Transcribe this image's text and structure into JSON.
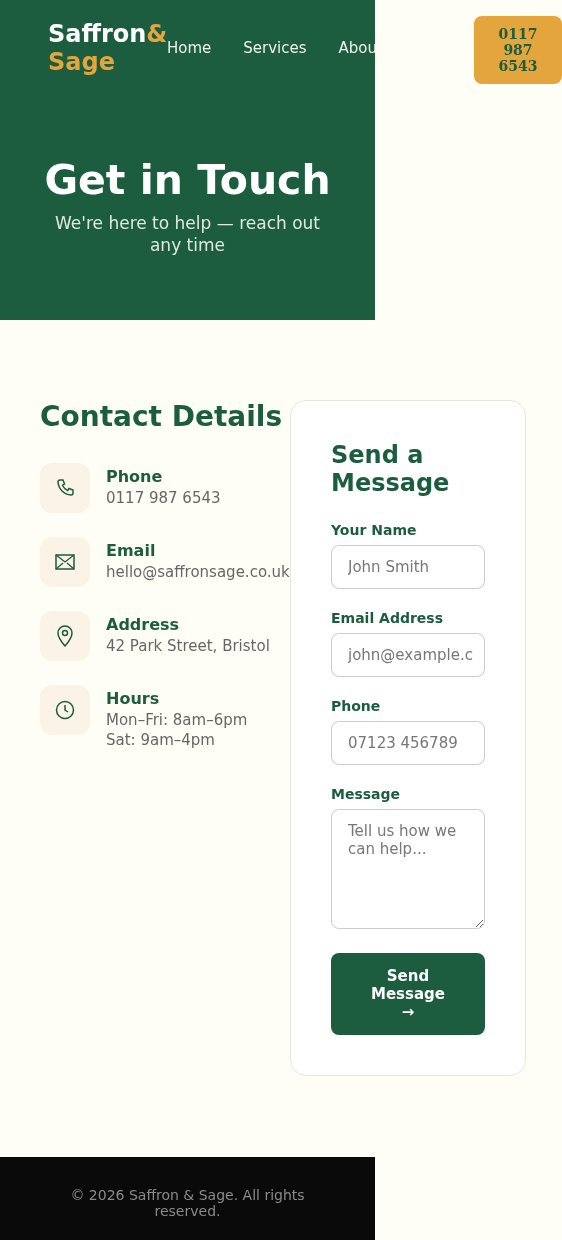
{
  "logo": {
    "primary": "Saffron",
    "accent": "& Sage"
  },
  "nav": [
    {
      "label": "Home"
    },
    {
      "label": "Services"
    },
    {
      "label": "Abou"
    }
  ],
  "call_button": {
    "label": "0117 987 6543"
  },
  "hero": {
    "title": "Get in Touch",
    "subtitle": "We're here to help — reach out any time"
  },
  "contact": {
    "heading": "Contact Details",
    "items": [
      {
        "kind": "phone",
        "label": "Phone",
        "lines": [
          "0117 987 6543"
        ]
      },
      {
        "kind": "email",
        "label": "Email",
        "lines": [
          "hello@saffronsage.co.uk"
        ]
      },
      {
        "kind": "address",
        "label": "Address",
        "lines": [
          "42 Park Street, Bristol"
        ]
      },
      {
        "kind": "hours",
        "label": "Hours",
        "lines": [
          "Mon–Fri: 8am–6pm",
          "Sat: 9am–4pm"
        ]
      }
    ]
  },
  "form": {
    "title": "Send a Message",
    "fields": [
      {
        "kind": "text",
        "label": "Your Name",
        "placeholder": "John Smith"
      },
      {
        "kind": "text",
        "label": "Email Address",
        "placeholder": "john@example.c"
      },
      {
        "kind": "text",
        "label": "Phone",
        "placeholder": "07123 456789"
      },
      {
        "kind": "textarea",
        "label": "Message",
        "placeholder": "Tell us how we can help..."
      }
    ],
    "submit": "Send Message →"
  },
  "footer": {
    "text": "© 2026 Saffron & Sage. All rights reserved."
  }
}
